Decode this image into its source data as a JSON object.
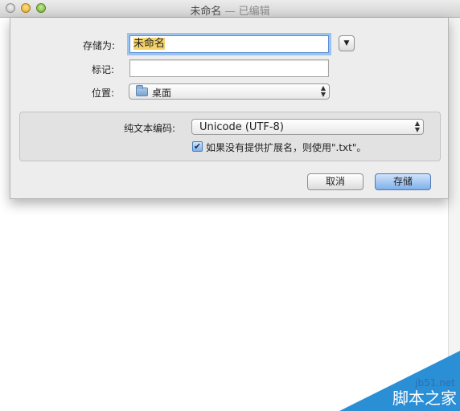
{
  "window": {
    "title": "未命名",
    "separator": " — ",
    "status": "已编辑"
  },
  "save_sheet": {
    "save_as_label": "存储为:",
    "save_as_value": "未命名",
    "tags_label": "标记:",
    "tags_value": "",
    "location_label": "位置:",
    "location_value": "桌面",
    "encoding_label": "纯文本编码:",
    "encoding_value": "Unicode (UTF-8)",
    "extension_checkbox_label": "如果没有提供扩展名，则使用\".txt\"。",
    "extension_checked": true,
    "cancel_label": "取消",
    "save_label": "存储"
  },
  "watermark": {
    "site": "jb51.net",
    "name": "脚本之家"
  },
  "icons": {
    "expand": "chevron-down-icon",
    "location": "folder-icon",
    "popup": "up-down-arrows-icon",
    "check": "checkmark-icon"
  }
}
